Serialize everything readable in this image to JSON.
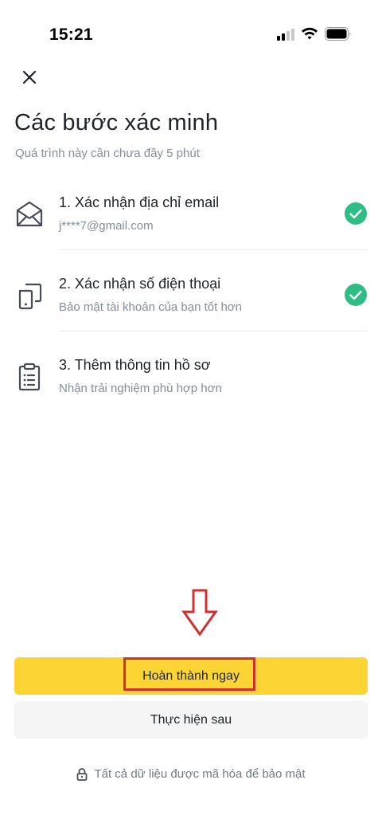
{
  "status_bar": {
    "time": "15:21"
  },
  "header": {
    "close_icon": "close-icon"
  },
  "page": {
    "title": "Các bước xác minh",
    "subtitle": "Quá trình này cần chưa đầy 5 phút"
  },
  "steps": [
    {
      "icon": "envelope-icon",
      "title": "1. Xác nhận địa chỉ email",
      "desc": "j****7@gmail.com",
      "completed": true
    },
    {
      "icon": "phone-icon",
      "title": "2. Xác nhận số điện thoại",
      "desc": "Bảo mật tài khoản của bạn tốt hơn",
      "completed": true
    },
    {
      "icon": "clipboard-icon",
      "title": "3. Thêm thông tin hồ sơ",
      "desc": "Nhận trải nghiệm phù hợp hơn",
      "completed": false
    }
  ],
  "actions": {
    "primary_label": "Hoàn thành ngay",
    "secondary_label": "Thực hiện sau"
  },
  "footer": {
    "note": "Tất cả dữ liệu được mã hóa để bảo mật",
    "icon": "lock-icon"
  },
  "colors": {
    "brand_yellow": "#fcd535",
    "success_green": "#2ebd85",
    "annotation_red": "#d32f2f",
    "text_primary": "#1e2329",
    "text_secondary": "#848e9c"
  }
}
